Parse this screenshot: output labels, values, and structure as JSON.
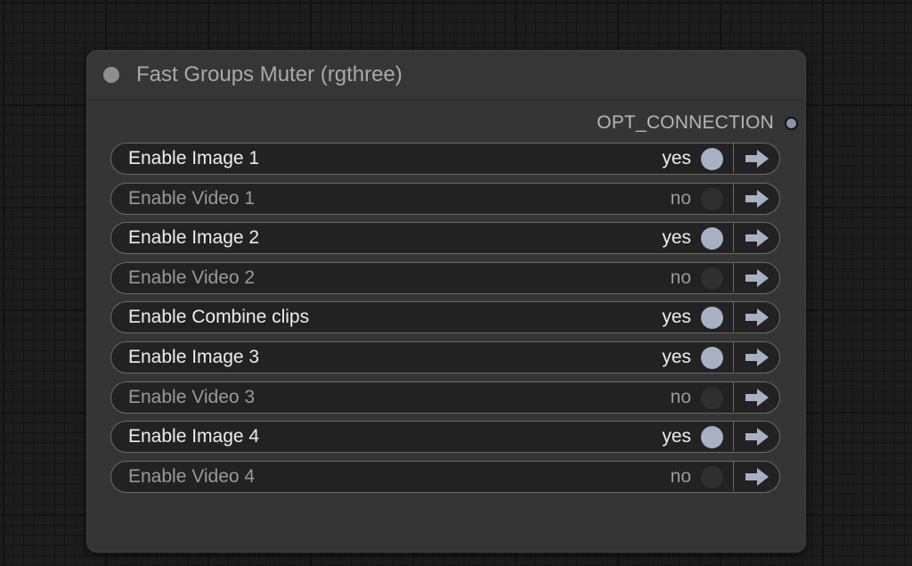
{
  "node": {
    "title": "Fast Groups Muter (rgthree)",
    "output_label": "OPT_CONNECTION"
  },
  "colors": {
    "toggle_on": "#a6b1c4",
    "toggle_off": "#2f2f2f",
    "arrow": "#a6b1c4"
  },
  "rows": [
    {
      "label": "Enable Image 1",
      "state": "yes",
      "enabled": true
    },
    {
      "label": "Enable Video 1",
      "state": "no",
      "enabled": false
    },
    {
      "label": "Enable Image 2",
      "state": "yes",
      "enabled": true
    },
    {
      "label": "Enable Video 2",
      "state": "no",
      "enabled": false
    },
    {
      "label": "Enable Combine clips",
      "state": "yes",
      "enabled": true
    },
    {
      "label": "Enable Image 3",
      "state": "yes",
      "enabled": true
    },
    {
      "label": "Enable Video 3",
      "state": "no",
      "enabled": false
    },
    {
      "label": "Enable Image 4",
      "state": "yes",
      "enabled": true
    },
    {
      "label": "Enable Video 4",
      "state": "no",
      "enabled": false
    }
  ],
  "icons": {
    "collapse": "circle-dot-icon",
    "navigate": "arrow-right-icon"
  }
}
